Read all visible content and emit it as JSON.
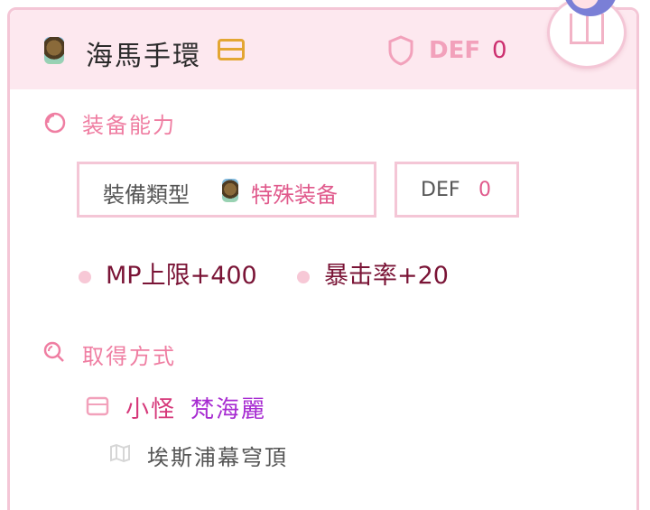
{
  "item": {
    "name": "海馬手環",
    "stat_label": "DEF",
    "stat_value": "0"
  },
  "ability": {
    "title": "装备能力",
    "type_label": "裝備類型",
    "type_value": "特殊装备",
    "def_label": "DEF",
    "def_value": "0",
    "stats": [
      "MP上限+400",
      "暴击率+20"
    ]
  },
  "acquire": {
    "title": "取得方式",
    "source_type": "小怪",
    "source_name": "梵海麗",
    "location": "埃斯浦幕穹頂"
  },
  "colors": {
    "accent_pink": "#ef7ea2",
    "header_bg": "#fde8ef",
    "border": "#f4c6d6",
    "stat_text": "#7a1436",
    "monster_name": "#a72bd1"
  },
  "icons": {
    "item": "bracelet-item-icon",
    "equip_box": "box-icon",
    "defense": "shield-icon",
    "codex": "book-icon",
    "ability": "spiral-icon",
    "acquire": "search-icon",
    "monster": "inbox-icon",
    "map": "map-icon"
  }
}
